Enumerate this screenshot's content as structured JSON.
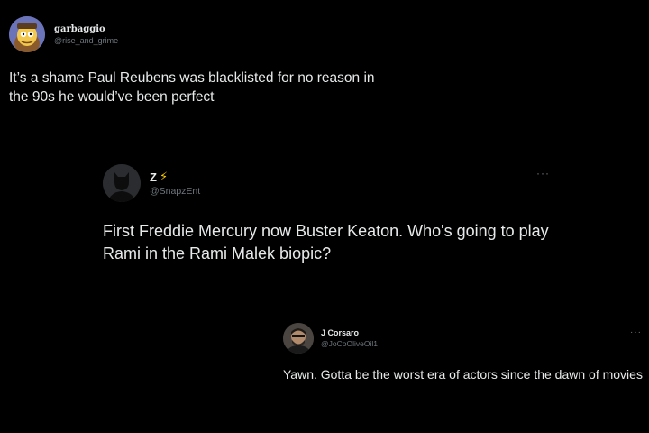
{
  "tweets": [
    {
      "display_name": "garbaggio",
      "handle": "@rise_and_grime",
      "text": "It’s a shame Paul Reubens was blacklisted for no reason in the 90s he would’ve been perfect",
      "avatar_icon": "cartoon-avatar-icon"
    },
    {
      "display_name": "Z",
      "name_emoji": "⚡",
      "handle": "@SnapzEnt",
      "text": "First Freddie Mercury now Buster Keaton. Who's going to play Rami in the Rami Malek biopic?",
      "more_label": "···",
      "avatar_icon": "silhouette-avatar-icon"
    },
    {
      "display_name": "J Corsaro",
      "handle": "@JoCoOliveOil1",
      "text": "Yawn. Gotta be the worst era of actors since the dawn of movies",
      "more_label": "···",
      "avatar_icon": "photo-avatar-icon"
    }
  ],
  "colors": {
    "background": "#000000",
    "text": "#e7e9ea",
    "secondary": "#6e767d",
    "lightning": "#f5c400"
  }
}
